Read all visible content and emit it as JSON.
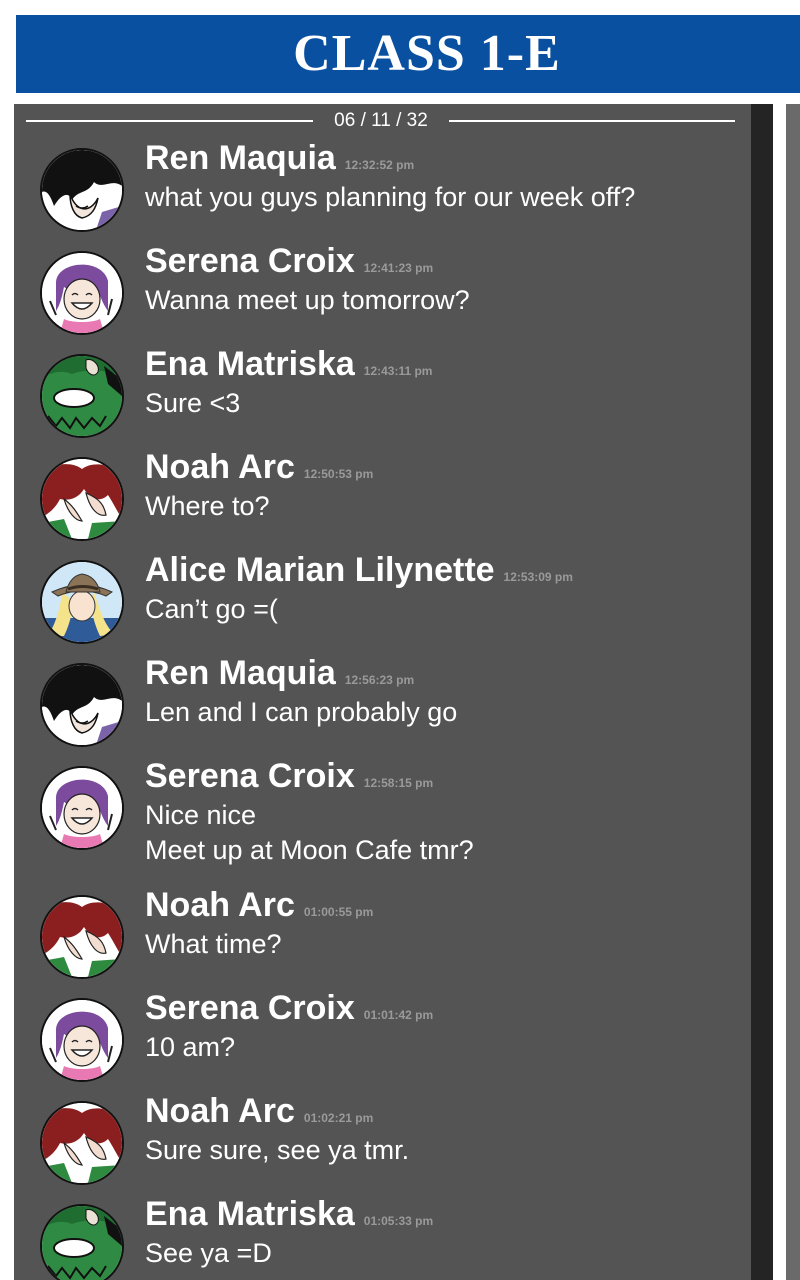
{
  "header": {
    "title": "CLASS 1-E",
    "background_color": "#0a50a0"
  },
  "chat": {
    "date": "06 / 11 / 32",
    "messages": [
      {
        "sender": "Ren Maquia",
        "time": "12:32:52 pm",
        "lines": [
          "what you guys planning for our week off?"
        ],
        "avatar": "ren-avatar"
      },
      {
        "sender": "Serena Croix",
        "time": "12:41:23 pm",
        "lines": [
          "Wanna meet up tomorrow?"
        ],
        "avatar": "serena-avatar"
      },
      {
        "sender": "Ena Matriska",
        "time": "12:43:11 pm",
        "lines": [
          "Sure <3"
        ],
        "avatar": "ena-avatar"
      },
      {
        "sender": "Noah Arc",
        "time": "12:50:53 pm",
        "lines": [
          "Where to?"
        ],
        "avatar": "noah-avatar"
      },
      {
        "sender": "Alice Marian Lilynette",
        "time": "12:53:09 pm",
        "lines": [
          "Can’t go =("
        ],
        "avatar": "alice-avatar"
      },
      {
        "sender": "Ren Maquia",
        "time": "12:56:23 pm",
        "lines": [
          "Len and I can probably go"
        ],
        "avatar": "ren-avatar"
      },
      {
        "sender": "Serena Croix",
        "time": "12:58:15 pm",
        "lines": [
          "Nice nice",
          "Meet up at Moon Cafe tmr?"
        ],
        "avatar": "serena-avatar"
      },
      {
        "sender": "Noah Arc",
        "time": "01:00:55 pm",
        "lines": [
          "What time?"
        ],
        "avatar": "noah-avatar"
      },
      {
        "sender": "Serena Croix",
        "time": "01:01:42 pm",
        "lines": [
          "10 am?"
        ],
        "avatar": "serena-avatar"
      },
      {
        "sender": "Noah Arc",
        "time": "01:02:21 pm",
        "lines": [
          "Sure sure, see ya tmr."
        ],
        "avatar": "noah-avatar"
      },
      {
        "sender": "Ena Matriska",
        "time": "01:05:33 pm",
        "lines": [
          "See ya =D"
        ],
        "avatar": "ena-avatar"
      }
    ]
  }
}
